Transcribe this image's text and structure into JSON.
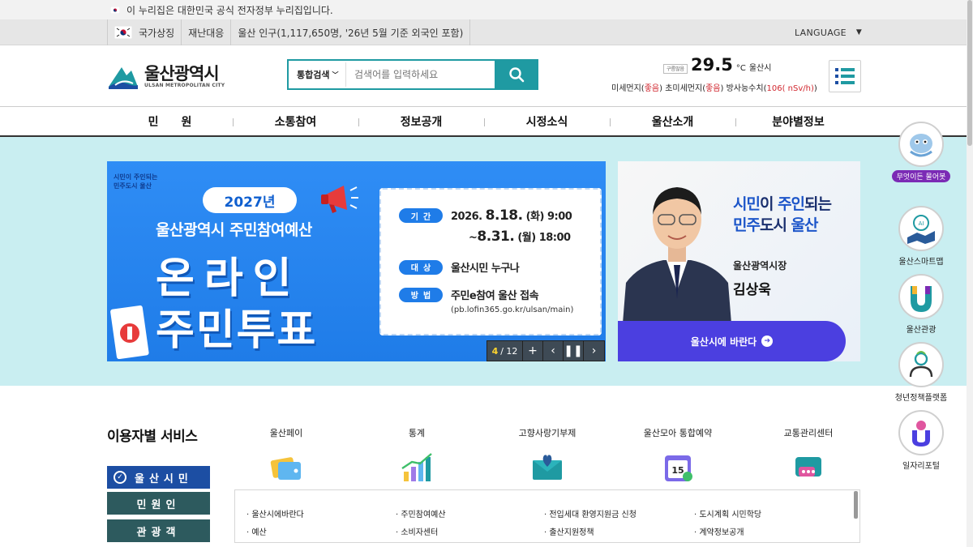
{
  "gov_notice": "이 누리집은 대한민국 공식 전자정부 누리집입니다.",
  "util": {
    "items": [
      "국가상징",
      "재난대응",
      "울산 인구(1,117,650명, '26년 5월 기준 외국인 포함)"
    ],
    "language": "LANGUAGE"
  },
  "logo": {
    "ko": "울산광역시",
    "en": "ULSAN METROPOLITAN CITY"
  },
  "search": {
    "scope": "통합검색",
    "placeholder": "검색어를 입력하세요"
  },
  "weather": {
    "icon_alt": "구름많음",
    "temp": "29.5",
    "unit": "°C",
    "city": "울산시",
    "pm10_label": "미세먼지(",
    "pm10_value": "좋음",
    "pm25_label": ") 초미세먼지(",
    "pm25_value": "좋음",
    "rad_label": ") 방사능수치(",
    "rad_value": "106( nSv/h)",
    "rad_close": ")"
  },
  "gnb": [
    "민　　원",
    "소통참여",
    "정보공개",
    "시정소식",
    "울산소개",
    "분야별정보"
  ],
  "banner": {
    "tag1": "시민이 주인되는",
    "tag2": "민주도시 울산",
    "year": "2027년",
    "subtitle": "울산광역시 주민참여예산",
    "big1": "온라인",
    "big2": "주민투표",
    "period_label": "기간",
    "period_start_pre": "2026.",
    "period_start_big": "8.18.",
    "period_start_post": "(화) 9:00",
    "period_end_pre": "~",
    "period_end_big": "8.31.",
    "period_end_post": "(월) 18:00",
    "target_label": "대상",
    "target_value": "울산시민 누구나",
    "method_label": "방법",
    "method_value": "주민e참여 울산 접속",
    "url": "(pb.lofin365.go.kr/ulsan/main)",
    "counter_current": "4",
    "counter_total": "/ 12"
  },
  "mayor": {
    "slogan_1a": "시민",
    "slogan_1b": "이 ",
    "slogan_1c": "주인",
    "slogan_1d": "되는",
    "slogan_2a": "민주",
    "slogan_2b": "도시 ",
    "slogan_2c": "울산",
    "role": "울산광역시장",
    "name": "김상욱",
    "cta": "울산시에 바란다"
  },
  "quick": [
    {
      "label": "무엇이든 물어봇"
    },
    {
      "label": "울산스마트맵"
    },
    {
      "label": "울산관광"
    },
    {
      "label": "청년정책플랫폼"
    },
    {
      "label": "일자리포털"
    }
  ],
  "services": {
    "title": "이용자별 서비스",
    "tabs": [
      "울산시민",
      "민원인",
      "관광객"
    ],
    "items": [
      "울산페이",
      "통계",
      "고향사랑기부제",
      "울산모아 통합예약",
      "교통관리센터"
    ],
    "calendar_day": "15",
    "links": [
      "· 울산시에바란다",
      "· 주민참여예산",
      "· 전입세대 환영지원금 신청",
      "· 도시계획 시민학당",
      "· 예산",
      "· 소비자센터",
      "· 출산지원정책",
      "· 계약정보공개"
    ]
  }
}
